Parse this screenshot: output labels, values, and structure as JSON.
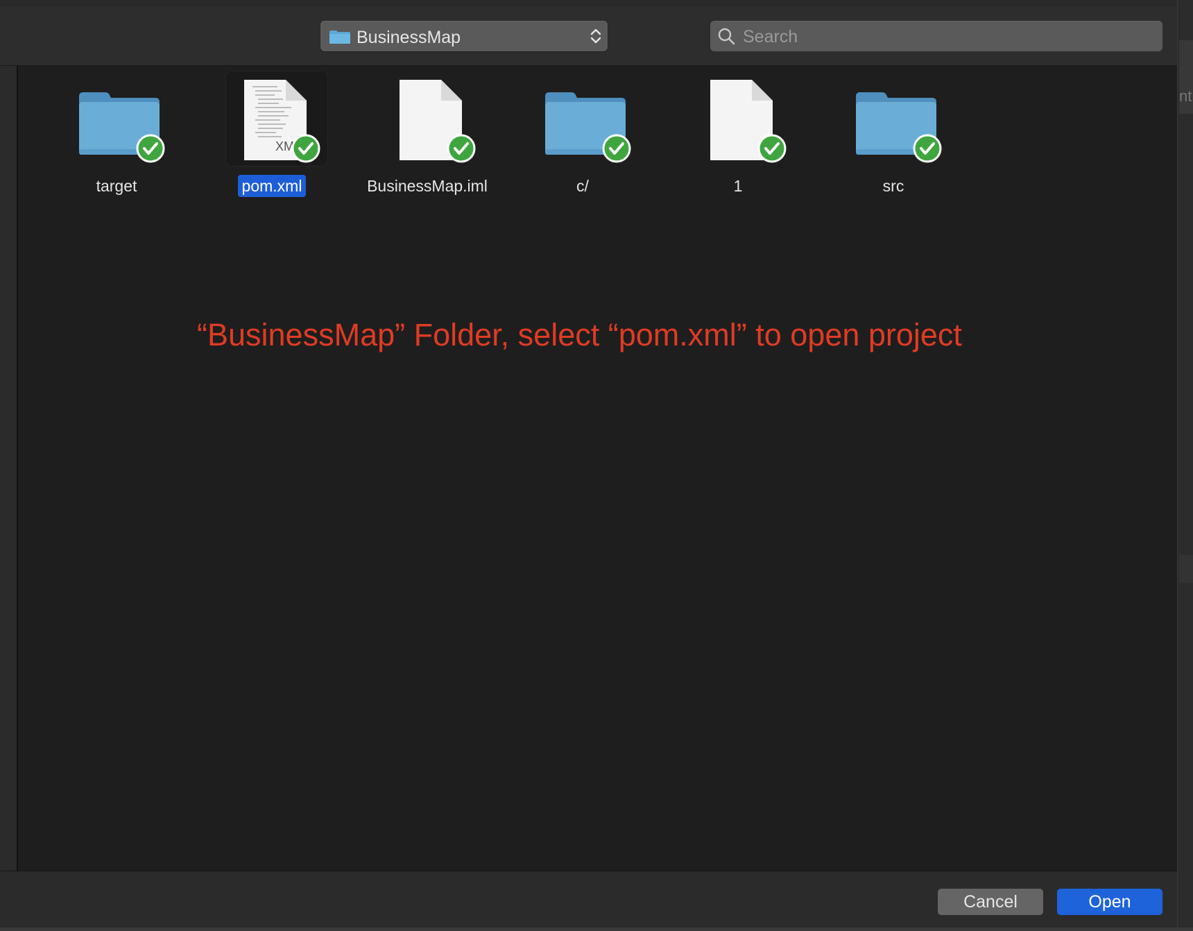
{
  "toolbar": {
    "location": {
      "label": "BusinessMap",
      "icon": "folder-icon"
    },
    "search": {
      "placeholder": "Search",
      "value": "",
      "icon": "search-icon"
    }
  },
  "files": [
    {
      "name": "target",
      "kind": "folder",
      "selected": false,
      "status": "synced-checkmark"
    },
    {
      "name": "pom.xml",
      "kind": "xml-document",
      "doc_label": "XML",
      "selected": true,
      "status": "synced-checkmark"
    },
    {
      "name": "BusinessMap.iml",
      "kind": "document",
      "selected": false,
      "status": "synced-checkmark"
    },
    {
      "name": "c/",
      "kind": "folder",
      "selected": false,
      "status": "synced-checkmark"
    },
    {
      "name": "1",
      "kind": "document",
      "selected": false,
      "status": "synced-checkmark"
    },
    {
      "name": "src",
      "kind": "folder",
      "selected": false,
      "status": "synced-checkmark"
    }
  ],
  "annotation": {
    "text": "“BusinessMap” Folder, select “pom.xml” to open project",
    "color": "#e03b24"
  },
  "right_strip": {
    "clipped_text": "ntr"
  },
  "footer": {
    "cancel_label": "Cancel",
    "open_label": "Open"
  },
  "colors": {
    "accent": "#1f63db",
    "selection": "#1d5ed8",
    "folder": "#6aaed8",
    "badge": "#3fa63f",
    "background": "#1e1e1e"
  }
}
